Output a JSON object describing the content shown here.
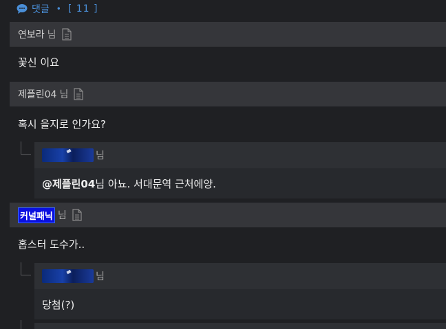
{
  "header": {
    "label": "댓글",
    "separator": "•",
    "count": "[ 11 ]",
    "accent": "#4a8fd8"
  },
  "comments": [
    {
      "author": "연보라",
      "suffix": "님",
      "text": "꽃신 이요"
    },
    {
      "author": "제플린04",
      "suffix": "님",
      "text": "혹시 을지로 인가요?",
      "reply": {
        "suffix": "님",
        "mention": "@제플린04",
        "text": "님 아뇨. 서대문역 근처에양."
      }
    },
    {
      "author": "커널패닉",
      "suffix": "님",
      "text": "홉스터 도수가..",
      "reply": {
        "suffix": "님",
        "text": "당첨(?)"
      }
    }
  ]
}
